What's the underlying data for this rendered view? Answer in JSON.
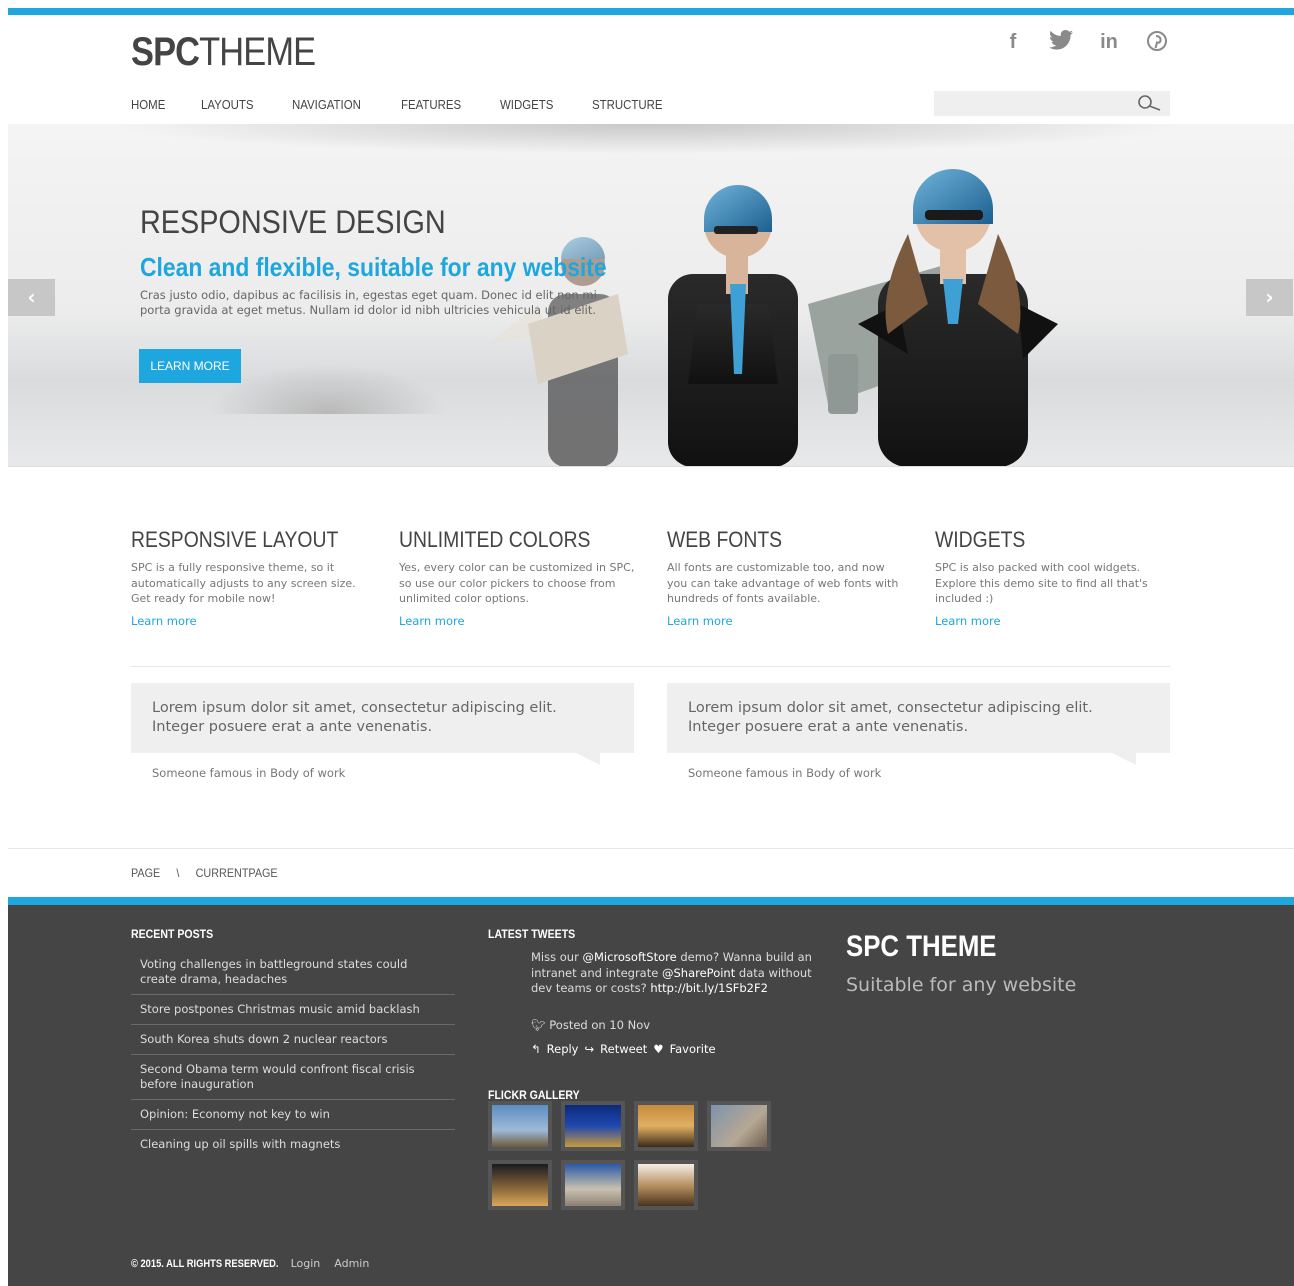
{
  "header": {
    "logo_bold": "SPC",
    "logo_light": "THEME",
    "social": [
      "facebook-icon",
      "twitter-icon",
      "linkedin-icon",
      "pinterest-icon"
    ],
    "nav": [
      "HOME",
      "LAYOUTS",
      "NAVIGATION",
      "FEATURES",
      "WIDGETS",
      "STRUCTURE"
    ],
    "search_placeholder": ""
  },
  "hero": {
    "title": "RESPONSIVE DESIGN",
    "subtitle": "Clean and flexible, suitable for any website",
    "body": "Cras justo odio, dapibus ac facilisis in, egestas eget quam. Donec id elit non mi porta gravida at eget metus. Nullam id dolor id nibh ultricies vehicula ut id elit.",
    "button": "LEARN MORE",
    "prev": "‹",
    "next": "›"
  },
  "features": [
    {
      "title": "RESPONSIVE LAYOUT",
      "text": "SPC is a fully responsive theme, so it automatically adjusts to any screen size. Get ready for mobile now!",
      "link": "Learn more"
    },
    {
      "title": "UNLIMITED COLORS",
      "text": "Yes, every color can be customized in SPC, so use our color pickers to choose from unlimited color options.",
      "link": "Learn more"
    },
    {
      "title": "WEB FONTS",
      "text": "All fonts are customizable too, and now you can take advantage of web fonts with hundreds of fonts available.",
      "link": "Learn more"
    },
    {
      "title": "WIDGETS",
      "text": "SPC is also packed with cool widgets. Explore this demo site to find all that's included :)",
      "link": "Learn more"
    }
  ],
  "quotes": [
    {
      "text": "Lorem ipsum dolor sit amet, consectetur adipiscing elit. Integer posuere erat a ante venenatis.",
      "cite": "Someone famous in Body of work"
    },
    {
      "text": "Lorem ipsum dolor sit amet, consectetur adipiscing elit. Integer posuere erat a ante venenatis.",
      "cite": "Someone famous in Body of work"
    }
  ],
  "breadcrumb": [
    "PAGE",
    "\\",
    "CURRENTPAGE"
  ],
  "footer": {
    "recent_title": "RECENT POSTS",
    "posts": [
      "Voting challenges in battleground states could create drama, headaches",
      "Store postpones Christmas music amid backlash",
      "South Korea shuts down 2 nuclear reactors",
      "Second Obama term would confront fiscal crisis before inauguration",
      "Opinion: Economy not key to win",
      "Cleaning up oil spills with magnets"
    ],
    "tweets_title": "LATEST TWEETS",
    "tweet_parts": [
      "Miss our ",
      "@MicrosoftStore",
      " demo? Wanna build an intranet and integrate ",
      "@SharePoint",
      " data without dev teams or costs? ",
      "http://bit.ly/1SFb2F2"
    ],
    "tweet_meta": "Posted on 10 Nov",
    "tweet_actions": [
      "Reply",
      "Retweet",
      "Favorite"
    ],
    "flickr_title": "FLICKR GALLERY",
    "brand": "SPC THEME",
    "tagline": "Suitable for any website",
    "copyright": "© 2015. ALL RIGHTS RESERVED.",
    "links": [
      "Login",
      "Admin"
    ]
  },
  "colors": {
    "accent": "#1ea6df",
    "footer_bg": "#454545"
  }
}
